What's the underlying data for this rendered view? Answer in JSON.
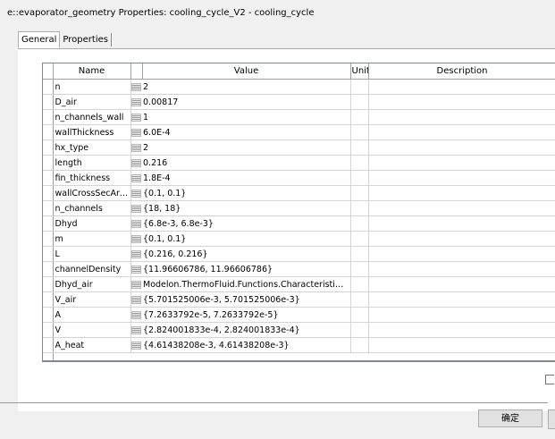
{
  "window": {
    "title": "e::evaporator_geometry Properties: cooling_cycle_V2 - cooling_cycle"
  },
  "tabs": [
    {
      "label": "General"
    },
    {
      "label": "Properties"
    }
  ],
  "table": {
    "columns": {
      "name": "Name",
      "value": "Value",
      "unit": "Unit",
      "description": "Description"
    },
    "rows": [
      {
        "name": "n",
        "value": "2"
      },
      {
        "name": "D_air",
        "value": "0.00817"
      },
      {
        "name": "n_channels_wall",
        "value": "1"
      },
      {
        "name": "wallThickness",
        "value": "6.0E-4"
      },
      {
        "name": "hx_type",
        "value": "2"
      },
      {
        "name": "length",
        "value": "0.216"
      },
      {
        "name": "fin_thickness",
        "value": "1.8E-4"
      },
      {
        "name": "wallCrossSecArea",
        "value": "{0.1, 0.1}"
      },
      {
        "name": "n_channels",
        "value": "{18, 18}"
      },
      {
        "name": "Dhyd",
        "value": "{6.8e-3, 6.8e-3}"
      },
      {
        "name": "m",
        "value": "{0.1, 0.1}"
      },
      {
        "name": "L",
        "value": "{0.216, 0.216}"
      },
      {
        "name": "channelDensity",
        "value": "{11.96606786, 11.96606786}"
      },
      {
        "name": "Dhyd_air",
        "value": "Modelon.ThermoFluid.Functions.CharacteristicN..."
      },
      {
        "name": "V_air",
        "value": "{5.701525006e-3, 5.701525006e-3}"
      },
      {
        "name": "A",
        "value": "{7.2633792e-5, 7.2633792e-5}"
      },
      {
        "name": "V",
        "value": "{2.824001833e-4, 2.824001833e-4}"
      },
      {
        "name": "A_heat",
        "value": "{4.61438208e-3, 4.61438208e-3}"
      }
    ]
  },
  "buttons": {
    "ok": "确定"
  },
  "icons": {
    "row_value_icon": "list-icon"
  }
}
